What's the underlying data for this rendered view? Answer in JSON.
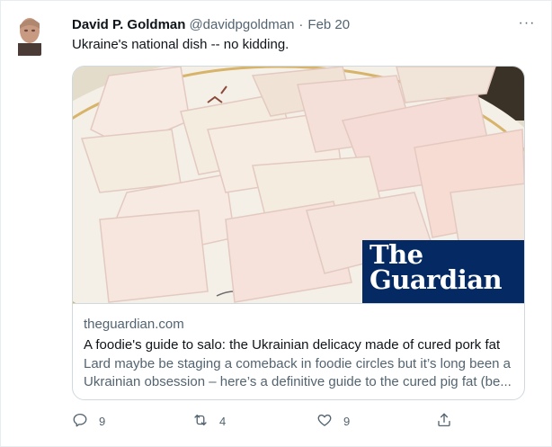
{
  "tweet": {
    "author_name": "David P. Goldman",
    "author_handle": "@davidpgoldman",
    "separator": "·",
    "date": "Feb 20",
    "more_glyph": "···",
    "text": "Ukraine's national dish -- no kidding."
  },
  "card": {
    "logo_line1": "The",
    "logo_line2": "Guardian",
    "domain": "theguardian.com",
    "title": "A foodie's guide to salo: the Ukrainian delicacy made of cured pork fat",
    "description": "Lard maybe be staging a comeback in foodie circles but it’s long been a Ukrainian obsession – here’s a definitive guide to the cured pig fat (be..."
  },
  "actions": {
    "reply_count": "9",
    "retweet_count": "4",
    "like_count": "9"
  },
  "icons": {
    "reply": "reply-icon",
    "retweet": "retweet-icon",
    "like": "like-icon",
    "share": "share-icon",
    "more": "more-icon"
  },
  "colors": {
    "primary_text": "#0f1419",
    "secondary_text": "#536471",
    "border": "#cfd9de",
    "guardian_blue": "#052962"
  }
}
